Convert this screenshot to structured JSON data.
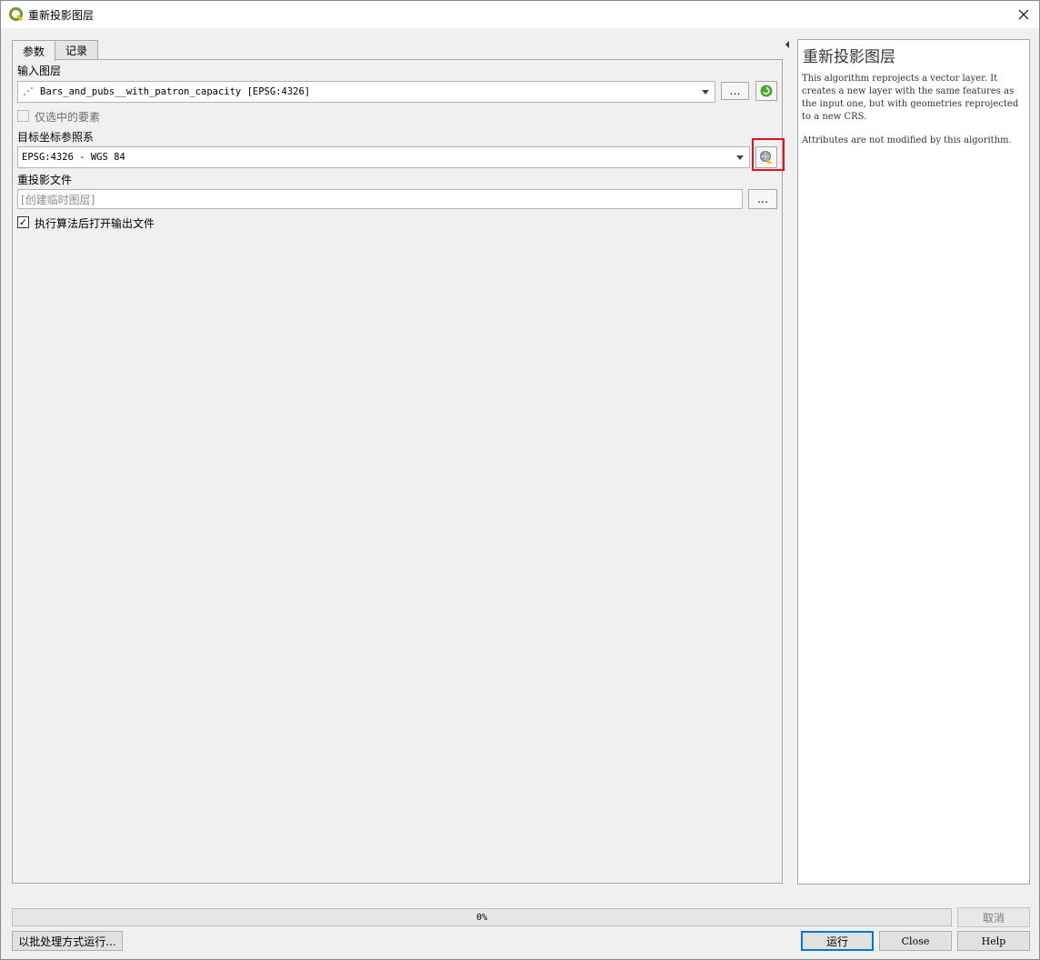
{
  "window": {
    "title": "重新投影图层"
  },
  "tabs": [
    {
      "label": "参数"
    },
    {
      "label": "记录"
    }
  ],
  "params": {
    "input_layer_label": "输入图层",
    "input_layer_value": "Bars_and_pubs__with_patron_capacity [EPSG:4326]",
    "selected_only_label": "仅选中的要素",
    "target_crs_label": "目标坐标参照系",
    "target_crs_value": "EPSG:4326 - WGS 84",
    "output_label": "重投影文件",
    "output_placeholder": "[创建临时图层]",
    "open_output_label": "执行算法后打开输出文件",
    "browse_label": "…"
  },
  "help": {
    "title": "重新投影图层",
    "paragraph1": "This algorithm reprojects a vector layer. It creates a new layer with the same features as the input one, but with geometries reprojected to a new CRS.",
    "paragraph2": "Attributes are not modified by this algorithm."
  },
  "progress": {
    "text": "0%",
    "value": 0
  },
  "buttons": {
    "cancel": "取消",
    "batch": "以批处理方式运行...",
    "run": "运行",
    "close": "Close",
    "help": "Help"
  },
  "colors": {
    "highlight": "#e3121d",
    "accent": "#0078d7"
  }
}
